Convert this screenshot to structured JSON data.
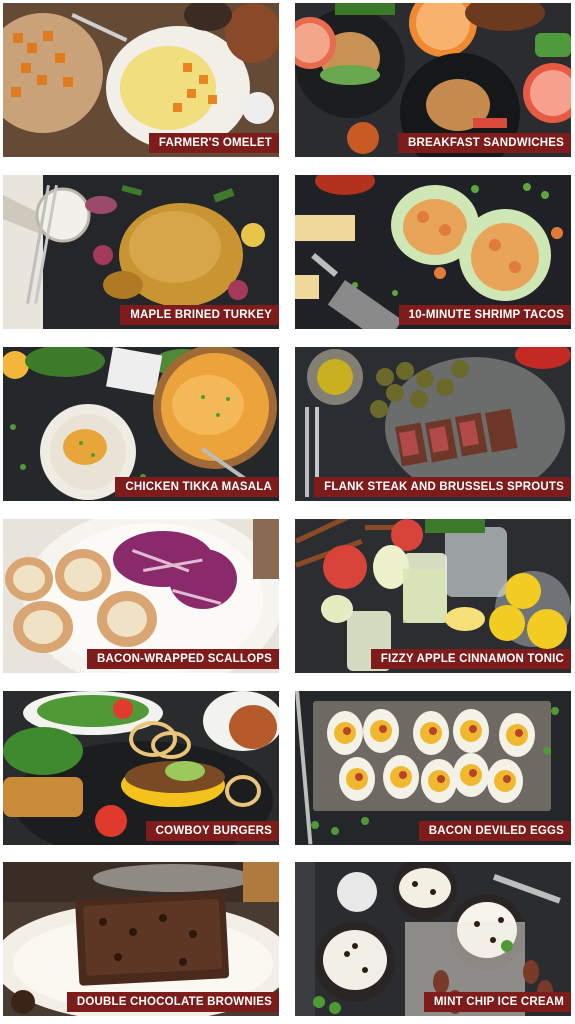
{
  "colors": {
    "label_background": "#7e1c1c",
    "label_text": "#ffffff",
    "page_background": "#ffffff"
  },
  "recipes": [
    {
      "title": "FARMER'S OMELET"
    },
    {
      "title": "BREAKFAST SANDWICHES"
    },
    {
      "title": "MAPLE BRINED TURKEY"
    },
    {
      "title": "10-MINUTE SHRIMP TACOS"
    },
    {
      "title": "CHICKEN TIKKA MASALA"
    },
    {
      "title": "FLANK STEAK AND BRUSSELS SPROUTS"
    },
    {
      "title": "BACON-WRAPPED SCALLOPS"
    },
    {
      "title": "FIZZY APPLE CINNAMON TONIC"
    },
    {
      "title": "COWBOY BURGERS"
    },
    {
      "title": "BACON DEVILED EGGS"
    },
    {
      "title": "DOUBLE CHOCOLATE BROWNIES"
    },
    {
      "title": "MINT CHIP ICE CREAM"
    }
  ]
}
